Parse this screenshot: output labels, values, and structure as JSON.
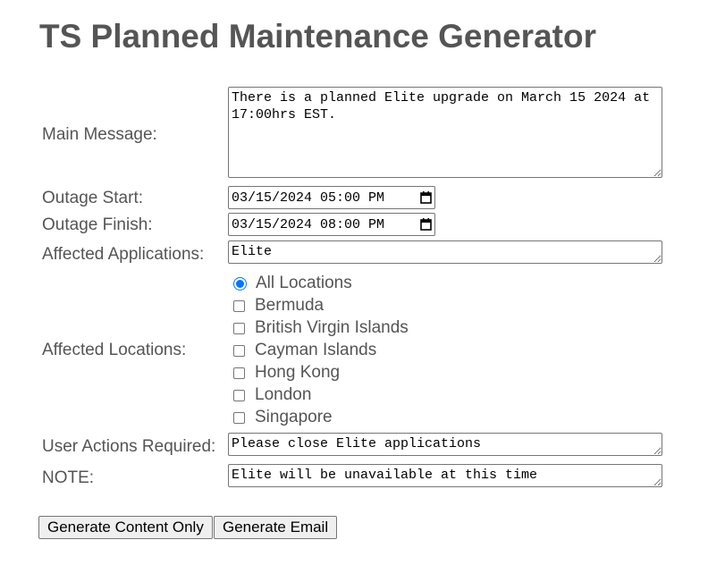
{
  "page": {
    "title": "TS Planned Maintenance Generator"
  },
  "form": {
    "main_message": {
      "label": "Main Message:",
      "value": "There is a planned Elite upgrade on March 15 2024 at 17:00hrs EST."
    },
    "outage_start": {
      "label": "Outage Start:",
      "value": "03/15/2024 05:00 PM"
    },
    "outage_finish": {
      "label": "Outage Finish:",
      "value": "03/15/2024 08:00 PM"
    },
    "affected_applications": {
      "label": "Affected Applications:",
      "value": "Elite"
    },
    "affected_locations": {
      "label": "Affected Locations:",
      "all_option": {
        "label": "All Locations",
        "selected": true
      },
      "options": [
        {
          "label": "Bermuda",
          "checked": false
        },
        {
          "label": "British Virgin Islands",
          "checked": false
        },
        {
          "label": "Cayman Islands",
          "checked": false
        },
        {
          "label": "Hong Kong",
          "checked": false
        },
        {
          "label": "London",
          "checked": false
        },
        {
          "label": "Singapore",
          "checked": false
        }
      ]
    },
    "user_actions": {
      "label": "User Actions Required:",
      "value": "Please close Elite applications"
    },
    "note": {
      "label": "NOTE:",
      "value": "Elite will be unavailable at this time"
    }
  },
  "buttons": {
    "generate_content": "Generate Content Only",
    "generate_email": "Generate Email"
  },
  "colors": {
    "text": "#555555",
    "accent": "#0075ff",
    "button_bg": "#efefef",
    "border": "#767676"
  }
}
